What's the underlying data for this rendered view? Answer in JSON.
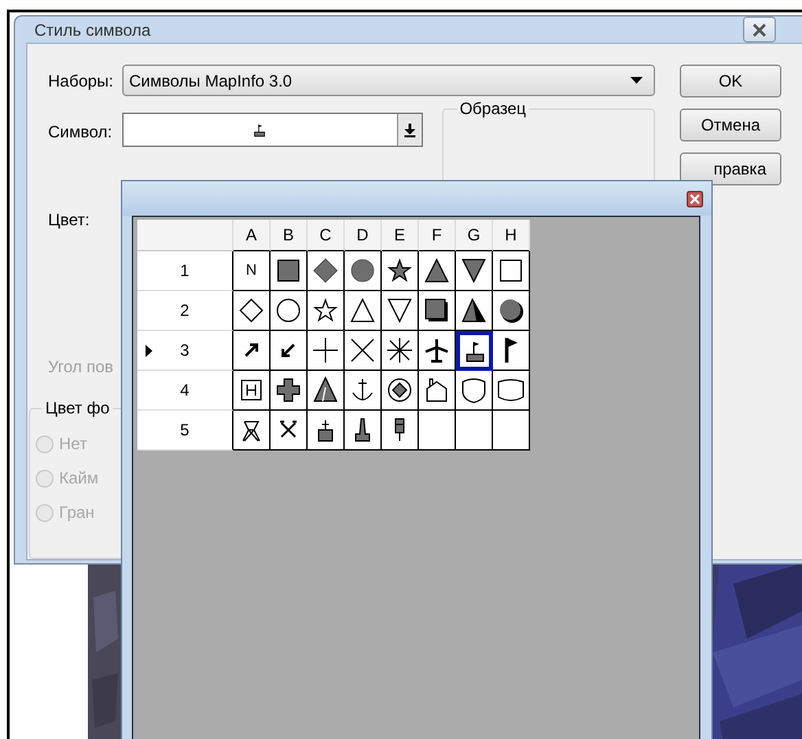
{
  "dialog": {
    "title": "Стиль символа",
    "sets": {
      "label": "Наборы:",
      "value": "Символы MapInfo 3.0"
    },
    "symbol": {
      "label": "Символ:"
    },
    "color": {
      "label": "Цвет:"
    },
    "sample": {
      "title": "Образец"
    },
    "angle": {
      "label": "Угол пов",
      "disabled": true
    },
    "background": {
      "title": "Цвет фо",
      "options": [
        {
          "label": "Нет",
          "selected": false,
          "disabled": true
        },
        {
          "label": "Кайм",
          "selected": false,
          "disabled": true
        },
        {
          "label": "Гран",
          "selected": false,
          "disabled": true
        }
      ]
    },
    "buttons": [
      "OK",
      "Отмена",
      "правка"
    ]
  },
  "palette": {
    "columns": [
      "A",
      "B",
      "C",
      "D",
      "E",
      "F",
      "G",
      "H"
    ],
    "rows": [
      {
        "label": "1",
        "current": false,
        "cells": [
          {
            "kind": "letter",
            "text": "N",
            "selected": false
          },
          {
            "kind": "square-filled",
            "selected": false
          },
          {
            "kind": "diamond-filled",
            "selected": false
          },
          {
            "kind": "circle-filled",
            "selected": false
          },
          {
            "kind": "star-filled",
            "selected": false
          },
          {
            "kind": "triangle-filled",
            "selected": false
          },
          {
            "kind": "triangle-down-filled",
            "selected": false
          },
          {
            "kind": "square-outline",
            "selected": false
          }
        ]
      },
      {
        "label": "2",
        "current": false,
        "cells": [
          {
            "kind": "diamond-outline",
            "selected": false
          },
          {
            "kind": "circle-outline",
            "selected": false
          },
          {
            "kind": "star-outline",
            "selected": false
          },
          {
            "kind": "triangle-outline",
            "selected": false
          },
          {
            "kind": "triangle-down-outline",
            "selected": false
          },
          {
            "kind": "square-shadow",
            "selected": false
          },
          {
            "kind": "pyramid",
            "selected": false
          },
          {
            "kind": "sphere",
            "selected": false
          }
        ]
      },
      {
        "label": "3",
        "current": true,
        "cells": [
          {
            "kind": "arrow-ne",
            "selected": false
          },
          {
            "kind": "arrow-sw",
            "selected": false
          },
          {
            "kind": "plus",
            "selected": false
          },
          {
            "kind": "cross",
            "selected": false
          },
          {
            "kind": "asterisk",
            "selected": false
          },
          {
            "kind": "airplane",
            "selected": false
          },
          {
            "kind": "flag-base",
            "selected": true
          },
          {
            "kind": "flag",
            "selected": false
          }
        ]
      },
      {
        "label": "4",
        "current": false,
        "cells": [
          {
            "kind": "hospital",
            "selected": false
          },
          {
            "kind": "cross-filled",
            "selected": false
          },
          {
            "kind": "tent",
            "selected": false
          },
          {
            "kind": "anchor",
            "selected": false
          },
          {
            "kind": "target",
            "selected": false
          },
          {
            "kind": "house",
            "selected": false
          },
          {
            "kind": "shield",
            "selected": false
          },
          {
            "kind": "shield-wide",
            "selected": false
          }
        ]
      },
      {
        "label": "5",
        "current": false,
        "cells": [
          {
            "kind": "tower",
            "selected": false
          },
          {
            "kind": "tools",
            "selected": false
          },
          {
            "kind": "church",
            "selected": false
          },
          {
            "kind": "monument",
            "selected": false
          },
          {
            "kind": "pin",
            "selected": false
          },
          {
            "kind": "empty",
            "selected": false
          },
          {
            "kind": "empty",
            "selected": false
          },
          {
            "kind": "empty",
            "selected": false
          }
        ]
      }
    ]
  }
}
